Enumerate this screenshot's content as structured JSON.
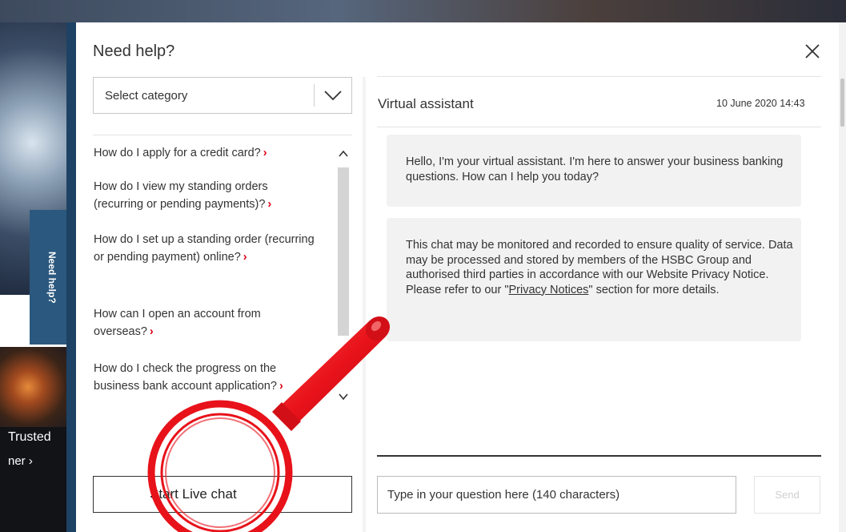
{
  "background": {
    "tagline": "Trusted",
    "link_text": "ner ›",
    "side_tab_label": "Need help?"
  },
  "modal": {
    "title": "Need help?",
    "close_icon": "close-icon",
    "category_select": {
      "selected": "Select category",
      "icon": "chevron-down-icon"
    },
    "faq": [
      {
        "text": "How do I apply for a credit card?",
        "arrow": "›"
      },
      {
        "text": "How do I view my standing orders (recurring or pending payments)?",
        "arrow": "›"
      },
      {
        "text": "How do I set up a standing order (recurring or pending payment) online?",
        "arrow": "›"
      },
      {
        "text": "How can I open an account from overseas?",
        "arrow": "›"
      },
      {
        "text": "How do I check the progress on the business bank account application?",
        "arrow": "›"
      }
    ],
    "start_live_chat_label": "Start Live chat"
  },
  "chat": {
    "title": "Virtual assistant",
    "timestamp": "10 June 2020 14:43",
    "messages": [
      {
        "text": "Hello, I'm your virtual assistant. I'm here to answer your business banking questions. How can I help you today?"
      },
      {
        "text_before": "This chat may be monitored and recorded to ensure quality of service. Data may be processed and stored by members of the HSBC Group and authorised third parties in accordance with our Website Privacy Notice. Please refer to our \"",
        "link": "Privacy Notices",
        "text_after": "\" section for more details."
      }
    ],
    "input_placeholder": "Type in your question here (140 characters)",
    "send_label": "Send"
  },
  "colors": {
    "accent_red": "#db0011",
    "panel_blue": "#2b587e",
    "annotation_red": "#e8121a"
  }
}
